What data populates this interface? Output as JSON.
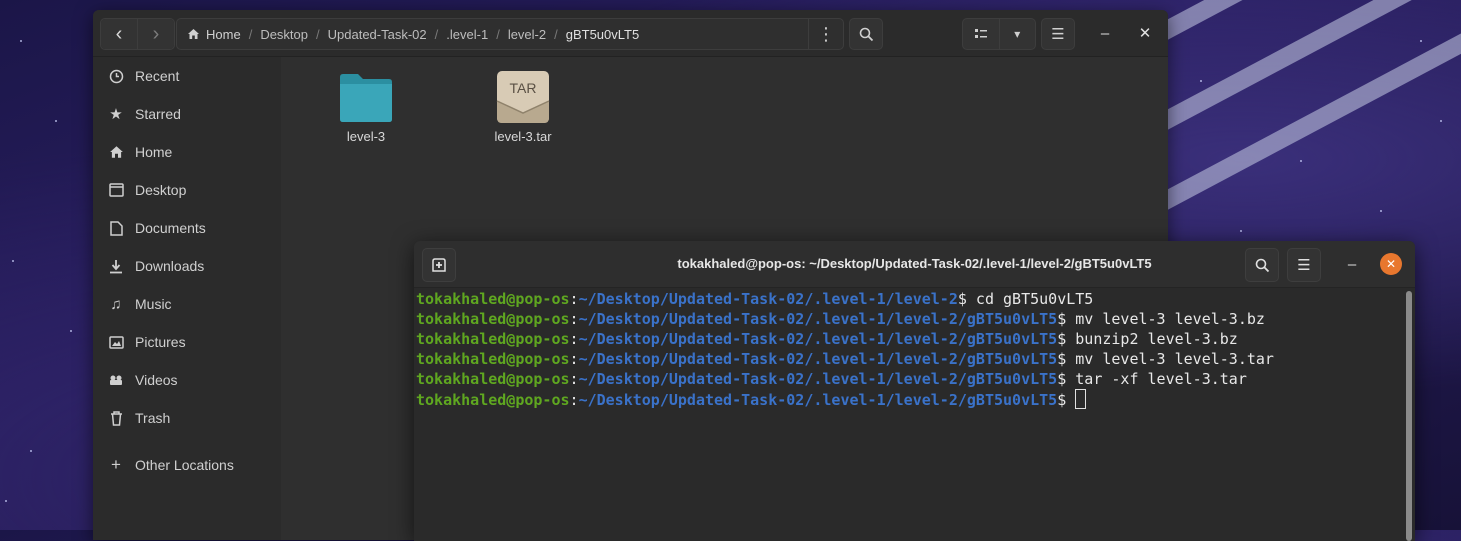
{
  "file_manager": {
    "path": [
      "Home",
      "Desktop",
      "Updated-Task-02",
      ".level-1",
      "level-2",
      "gBT5u0vLT5"
    ],
    "sidebar": [
      "Recent",
      "Starred",
      "Home",
      "Desktop",
      "Documents",
      "Downloads",
      "Music",
      "Pictures",
      "Videos",
      "Trash"
    ],
    "other_locations": "Other Locations",
    "files": [
      {
        "name": "level-3",
        "kind": "folder-icon"
      },
      {
        "name": "level-3.tar",
        "kind": "archive-icon",
        "badge": "TAR"
      }
    ]
  },
  "terminal": {
    "title": "tokakhaled@pop-os: ~/Desktop/Updated-Task-02/.level-1/level-2/gBT5u0vLT5",
    "user": "tokakhaled@pop-os",
    "lines": [
      {
        "path": "~/Desktop/Updated-Task-02/.level-1/level-2",
        "cmd": "cd gBT5u0vLT5"
      },
      {
        "path": "~/Desktop/Updated-Task-02/.level-1/level-2/gBT5u0vLT5",
        "cmd": "mv level-3 level-3.bz"
      },
      {
        "path": "~/Desktop/Updated-Task-02/.level-1/level-2/gBT5u0vLT5",
        "cmd": "bunzip2 level-3.bz"
      },
      {
        "path": "~/Desktop/Updated-Task-02/.level-1/level-2/gBT5u0vLT5",
        "cmd": "mv level-3 level-3.tar"
      },
      {
        "path": "~/Desktop/Updated-Task-02/.level-1/level-2/gBT5u0vLT5",
        "cmd": "tar -xf level-3.tar"
      },
      {
        "path": "~/Desktop/Updated-Task-02/.level-1/level-2/gBT5u0vLT5",
        "cmd": ""
      }
    ]
  },
  "colors": {
    "user": "#5fa720",
    "path": "#3a72c9",
    "close_accent": "#e8772e",
    "folder": "#3aa6b9"
  }
}
